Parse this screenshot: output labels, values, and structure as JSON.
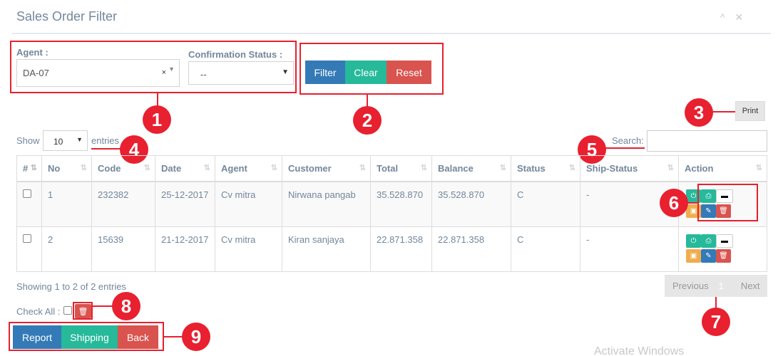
{
  "panel": {
    "title": "Sales Order Filter",
    "collapse_glyph": "^",
    "close_glyph": "✕"
  },
  "filter": {
    "agent_label": "Agent :",
    "agent_value": "DA-07",
    "agent_clear": "×",
    "confirmation_label": "Confirmation Status :",
    "confirmation_value": "--",
    "filter_btn": "Filter",
    "clear_btn": "Clear",
    "reset_btn": "Reset"
  },
  "print_btn": "Print",
  "entries": {
    "show_label": "Show",
    "value": "10",
    "suffix": "entries",
    "search_label": "Search:"
  },
  "table": {
    "columns": [
      "#",
      "No",
      "Code",
      "Date",
      "Agent",
      "Customer",
      "Total",
      "Balance",
      "Status",
      "Ship-Status",
      "Action"
    ],
    "rows": [
      {
        "no": "1",
        "code": "232382",
        "date": "25-12-2017",
        "agent": "Cv mitra",
        "customer": "Nirwana pangab",
        "total": "35.528.870",
        "balance": "35.528.870",
        "status": "C",
        "ship_status": "-"
      },
      {
        "no": "2",
        "code": "15639",
        "date": "21-12-2017",
        "agent": "Cv mitra",
        "customer": "Kiran sanjaya",
        "total": "22.871.358",
        "balance": "22.871.358",
        "status": "C",
        "ship_status": "-"
      }
    ]
  },
  "footer": {
    "showing": "Showing 1 to 2 of 2 entries",
    "previous": "Previous",
    "page": "1",
    "next": "Next",
    "check_all": "Check All :"
  },
  "bottom_buttons": {
    "report": "Report",
    "shipping": "Shipping",
    "back": "Back"
  },
  "callouts": [
    "1",
    "2",
    "3",
    "4",
    "5",
    "6",
    "7",
    "8",
    "9"
  ],
  "watermark": "Activate Windows",
  "colors": {
    "primary": "#337ab7",
    "success": "#26b99a",
    "danger": "#d9534f",
    "warning": "#f0ad4e",
    "annotation": "#e8202f"
  }
}
